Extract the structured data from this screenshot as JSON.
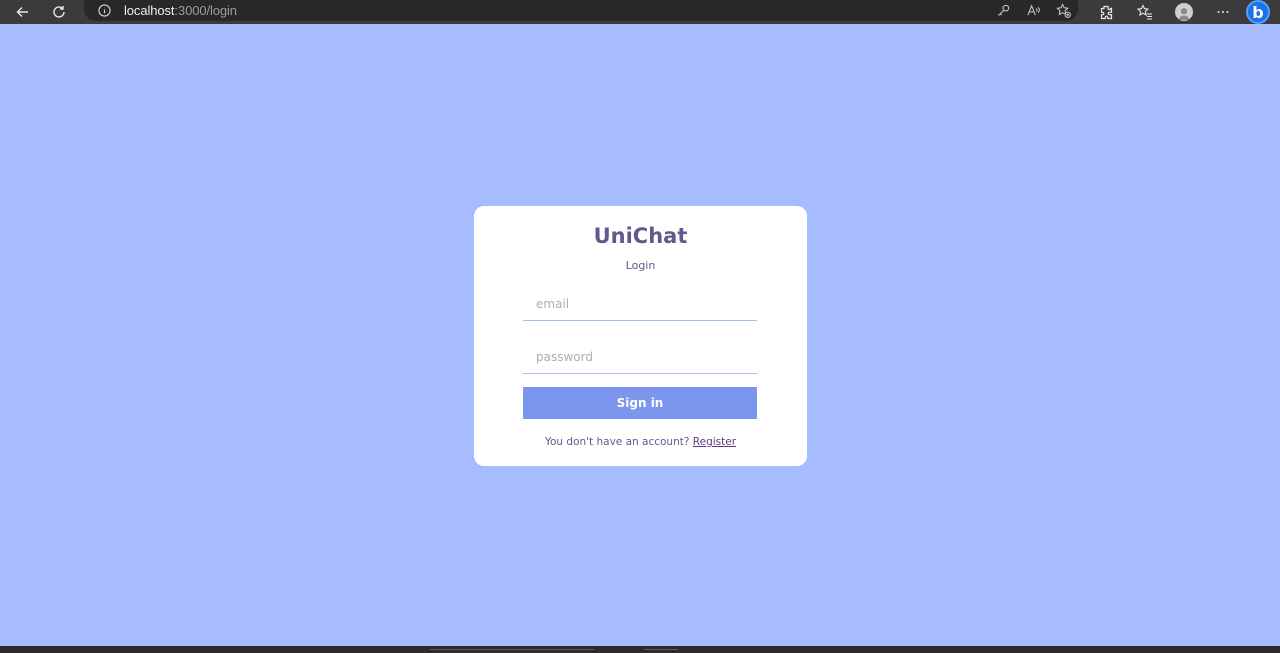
{
  "browser": {
    "url_host": "localhost",
    "url_path": ":3000/login",
    "icons": [
      "back-icon",
      "refresh-icon",
      "info-icon",
      "key-icon",
      "read-aloud-icon",
      "add-favorite-icon",
      "extensions-icon",
      "favorites-icon",
      "profile-icon",
      "more-icon",
      "bing-icon"
    ]
  },
  "login": {
    "app_title": "UniChat",
    "subtitle": "Login",
    "email_placeholder": "email",
    "password_placeholder": "password",
    "submit_label": "Sign in",
    "footer_prompt": "You don't have an account?",
    "register_link": "Register"
  },
  "colors": {
    "page_background": "#a7bcff",
    "card_background": "#ffffff",
    "brand_text": "#5d5b8d",
    "button_background": "#7b96ec"
  }
}
